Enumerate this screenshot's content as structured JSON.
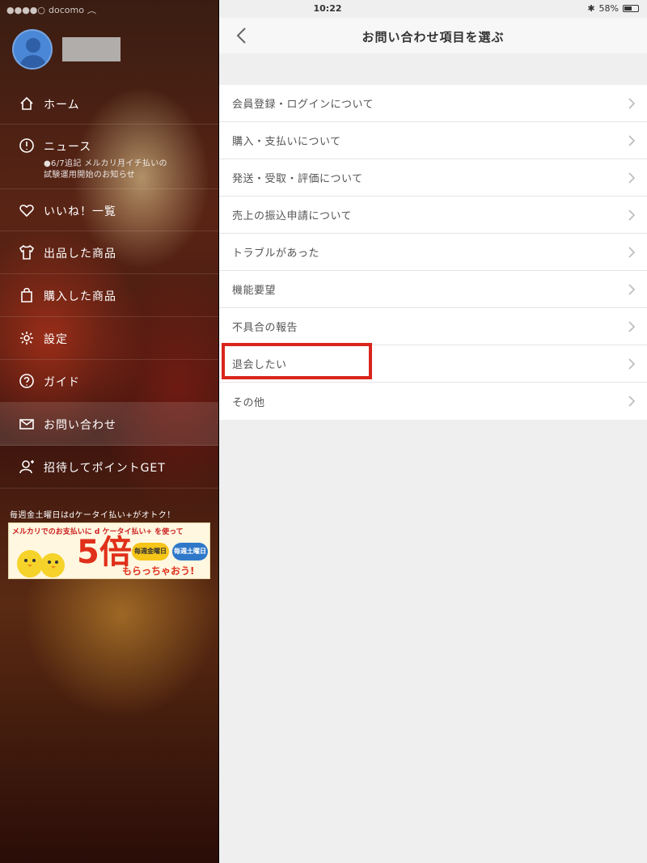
{
  "status_bar": {
    "carrier": "docomo",
    "time": "10:22",
    "battery": "58%"
  },
  "sidebar": {
    "menu": [
      {
        "id": "home",
        "label": "ホーム",
        "icon": "home-icon"
      },
      {
        "id": "news",
        "label": "ニュース",
        "icon": "info-icon",
        "sub": [
          "●6/7追記 メルカリ月イチ払いの",
          "試験運用開始のお知らせ"
        ]
      },
      {
        "id": "likes",
        "label": "いいね！一覧",
        "icon": "heart-icon"
      },
      {
        "id": "listed",
        "label": "出品した商品",
        "icon": "tshirt-icon"
      },
      {
        "id": "purchased",
        "label": "購入した商品",
        "icon": "shopping-bag-icon"
      },
      {
        "id": "settings",
        "label": "設定",
        "icon": "gear-icon"
      },
      {
        "id": "guide",
        "label": "ガイド",
        "icon": "question-icon"
      },
      {
        "id": "contact",
        "label": "お問い合わせ",
        "icon": "mail-icon",
        "active": true
      },
      {
        "id": "invite",
        "label": "招待してポイントGET",
        "icon": "invite-person-icon"
      }
    ],
    "promo": {
      "caption": "毎週金土曜日はdケータイ払い+がオトク！",
      "banner_line1": "メルカリでのお支払いに d ケータイ払い+ を使って",
      "banner_big": "5倍",
      "badge1": "毎週金曜日",
      "badge2": "毎週土曜日",
      "banner_line2": "もらっちゃおう!"
    }
  },
  "panel": {
    "title": "お問い合わせ項目を選ぶ",
    "items": [
      "会員登録・ログインについて",
      "購入・支払いについて",
      "発送・受取・評価について",
      "売上の振込申請について",
      "トラブルがあった",
      "機能要望",
      "不具合の報告",
      "退会したい",
      "その他"
    ],
    "highlight_color": "#d9251c"
  }
}
